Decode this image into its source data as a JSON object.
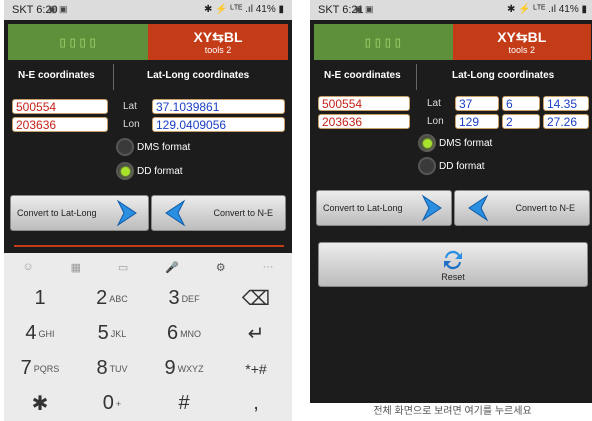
{
  "left": {
    "status": {
      "time": "SKT 6:20",
      "notif": "▣ ▣",
      "right": "✱ ⚡ ᴸᵀᴱ .ıl 41% ▮"
    },
    "tabs": {
      "logo_left": "▯▯▯▯",
      "logo_right": "XY⇆BL",
      "logo_right_sub": "tools 2"
    },
    "headers": {
      "ne": "N-E coordinates",
      "latlong": "Lat-Long coordinates"
    },
    "ne": {
      "northing": "500554",
      "easting": "203636"
    },
    "lat_label": "Lat",
    "lon_label": "Lon",
    "lat_value": "37.1039861",
    "lon_value": "129.0409056",
    "format": {
      "dms_label": "DMS format",
      "dd_label": "DD format",
      "selected": "DD"
    },
    "buttons": {
      "to_latlong": "Convert to Lat-Long",
      "to_ne": "Convert to N-E"
    },
    "keyboard": {
      "toprow": [
        "☺",
        "▦",
        "▭",
        "🎤",
        "⚙",
        "···"
      ],
      "rows": [
        [
          {
            "k": "1",
            "s": ""
          },
          {
            "k": "2",
            "s": "ABC"
          },
          {
            "k": "3",
            "s": "DEF"
          },
          {
            "k": "⌫",
            "s": ""
          }
        ],
        [
          {
            "k": "4",
            "s": "GHI"
          },
          {
            "k": "5",
            "s": "JKL"
          },
          {
            "k": "6",
            "s": "MNO"
          },
          {
            "k": "↵",
            "s": ""
          }
        ],
        [
          {
            "k": "7",
            "s": "PQRS"
          },
          {
            "k": "8",
            "s": "TUV"
          },
          {
            "k": "9",
            "s": "WXYZ"
          },
          {
            "k": "*+#",
            "s": ""
          }
        ],
        [
          {
            "k": "✱",
            "s": ""
          },
          {
            "k": "0",
            "s": "+"
          },
          {
            "k": "#",
            "s": ""
          },
          {
            "k": ",",
            "s": ""
          }
        ]
      ]
    }
  },
  "right": {
    "status": {
      "time": "SKT 6:21",
      "notif": "▣ ▣",
      "right": "✱ ⚡ ᴸᵀᴱ .ıl 41% ▮"
    },
    "tabs": {
      "logo_left": "▯▯▯▯",
      "logo_right": "XY⇆BL",
      "logo_right_sub": "tools 2"
    },
    "headers": {
      "ne": "N-E coordinates",
      "latlong": "Lat-Long coordinates"
    },
    "ne": {
      "northing": "500554",
      "easting": "203636"
    },
    "lat_label": "Lat",
    "lon_label": "Lon",
    "lat_dms": [
      "37",
      "6",
      "14.35"
    ],
    "lon_dms": [
      "129",
      "2",
      "27.26"
    ],
    "format": {
      "dms_label": "DMS format",
      "dd_label": "DD format",
      "selected": "DMS"
    },
    "buttons": {
      "to_latlong": "Convert to Lat-Long",
      "to_ne": "Convert to N-E",
      "reset": "Reset"
    },
    "footer": "전체 화면으로 보려면 여기를 누르세요"
  },
  "colors": {
    "accent_red": "#c43b17",
    "accent_green": "#5e8f3a",
    "value_red": "#c4221a",
    "value_blue": "#1c3fc4"
  }
}
